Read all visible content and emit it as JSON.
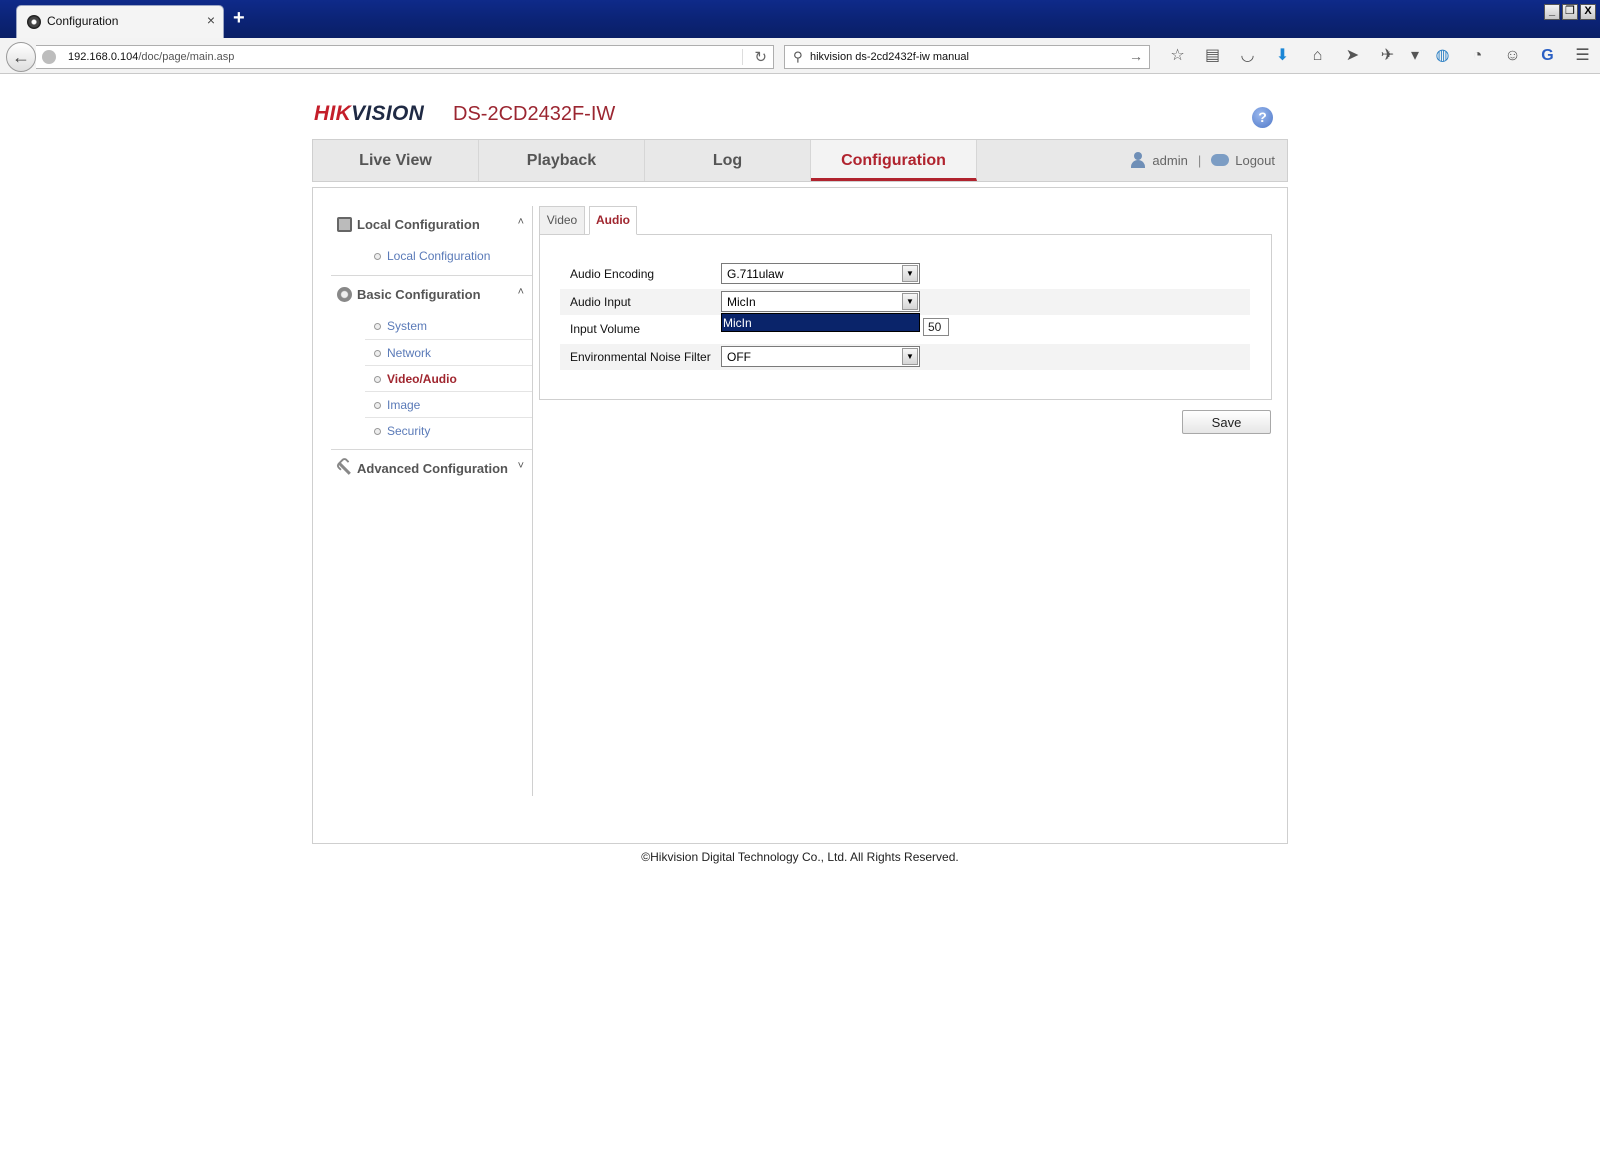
{
  "browser": {
    "tab_title": "Configuration",
    "tab_close": "×",
    "new_tab": "+",
    "window_buttons": [
      "_",
      "❐",
      "X"
    ],
    "url_host": "192.168.0.104",
    "url_path": "/doc/page/main.asp",
    "search_text": "hikvision ds-2cd2432f-iw manual",
    "toolbar_icons": [
      "star-icon",
      "reading-list-icon",
      "pocket-icon",
      "download-icon",
      "home-icon",
      "send-icon",
      "extension-icon",
      "dropdown-icon",
      "sync-icon",
      "history-icon",
      "chat-icon",
      "addon-g-icon",
      "menu-icon"
    ]
  },
  "header": {
    "brand_part1": "HIK",
    "brand_part2": "VISION",
    "model": "DS-2CD2432F-IW",
    "help": "?"
  },
  "mainnav": {
    "tabs": [
      "Live View",
      "Playback",
      "Log",
      "Configuration"
    ],
    "active": "Configuration",
    "user": "admin",
    "separator": "|",
    "logout": "Logout"
  },
  "sidebar": {
    "local_config": {
      "label": "Local Configuration",
      "toggle": "˄",
      "items": [
        "Local Configuration"
      ]
    },
    "basic_config": {
      "label": "Basic Configuration",
      "toggle": "˄",
      "items": [
        "System",
        "Network",
        "Video/Audio",
        "Image",
        "Security"
      ]
    },
    "advanced_config": {
      "label": "Advanced Configuration",
      "toggle": "˅"
    },
    "active_item": "Video/Audio"
  },
  "subtabs": {
    "video": "Video",
    "audio": "Audio",
    "active": "Audio"
  },
  "form": {
    "audio_encoding": {
      "label": "Audio Encoding",
      "value": "G.711ulaw"
    },
    "audio_input": {
      "label": "Audio Input",
      "value": "MicIn",
      "options": [
        "MicIn"
      ]
    },
    "input_volume": {
      "label": "Input Volume",
      "value": "50"
    },
    "noise_filter": {
      "label": "Environmental Noise Filter",
      "value": "OFF"
    },
    "arrow": "▼"
  },
  "save_label": "Save",
  "footer": "©Hikvision Digital Technology Co., Ltd. All Rights Reserved."
}
